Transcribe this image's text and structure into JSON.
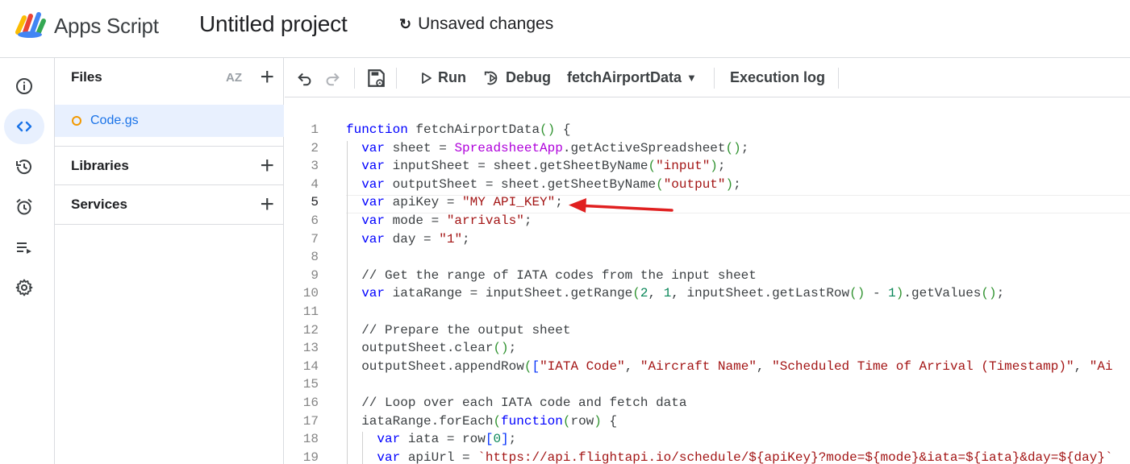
{
  "header": {
    "app_name": "Apps Script",
    "project_title": "Untitled project",
    "status": "Unsaved changes"
  },
  "rail": {
    "items": [
      {
        "name": "overview",
        "icon": "info-icon"
      },
      {
        "name": "editor",
        "icon": "code-icon",
        "active": true
      },
      {
        "name": "history",
        "icon": "history-icon"
      },
      {
        "name": "triggers",
        "icon": "alarm-icon"
      },
      {
        "name": "executions",
        "icon": "executions-icon"
      },
      {
        "name": "settings",
        "icon": "gear-icon"
      }
    ]
  },
  "files_panel": {
    "files_label": "Files",
    "sort_label": "AZ",
    "files": [
      {
        "name": "Code.gs"
      }
    ],
    "libraries_label": "Libraries",
    "services_label": "Services"
  },
  "toolbar": {
    "run_label": "Run",
    "debug_label": "Debug",
    "function_select": "fetchAirportData",
    "execution_log_label": "Execution log"
  },
  "editor": {
    "current_line": 5,
    "lines": [
      {
        "n": "1",
        "text": "function fetchAirportData() {"
      },
      {
        "n": "2",
        "text": "  var sheet = SpreadsheetApp.getActiveSpreadsheet();"
      },
      {
        "n": "3",
        "text": "  var inputSheet = sheet.getSheetByName(\"input\");"
      },
      {
        "n": "4",
        "text": "  var outputSheet = sheet.getSheetByName(\"output\");"
      },
      {
        "n": "5",
        "text": "  var apiKey = \"MY API_KEY\";"
      },
      {
        "n": "6",
        "text": "  var mode = \"arrivals\";"
      },
      {
        "n": "7",
        "text": "  var day = \"1\";"
      },
      {
        "n": "8",
        "text": ""
      },
      {
        "n": "9",
        "text": "  // Get the range of IATA codes from the input sheet"
      },
      {
        "n": "10",
        "text": "  var iataRange = inputSheet.getRange(2, 1, inputSheet.getLastRow() - 1).getValues();"
      },
      {
        "n": "11",
        "text": ""
      },
      {
        "n": "12",
        "text": "  // Prepare the output sheet"
      },
      {
        "n": "13",
        "text": "  outputSheet.clear();"
      },
      {
        "n": "14",
        "text": "  outputSheet.appendRow([\"IATA Code\", \"Aircraft Name\", \"Scheduled Time of Arrival (Timestamp)\", \"Ai"
      },
      {
        "n": "15",
        "text": ""
      },
      {
        "n": "16",
        "text": "  // Loop over each IATA code and fetch data"
      },
      {
        "n": "17",
        "text": "  iataRange.forEach(function(row) {"
      },
      {
        "n": "18",
        "text": "    var iata = row[0];"
      },
      {
        "n": "19",
        "text": "    var apiUrl = `https://api.flightapi.io/schedule/${apiKey}?mode=${mode}&iata=${iata}&day=${day}`"
      }
    ]
  },
  "colors": {
    "accent": "#1a73e8",
    "active_bg": "#e8f0fe",
    "file_dot": "#f29900",
    "annotation_arrow": "#e02020"
  }
}
